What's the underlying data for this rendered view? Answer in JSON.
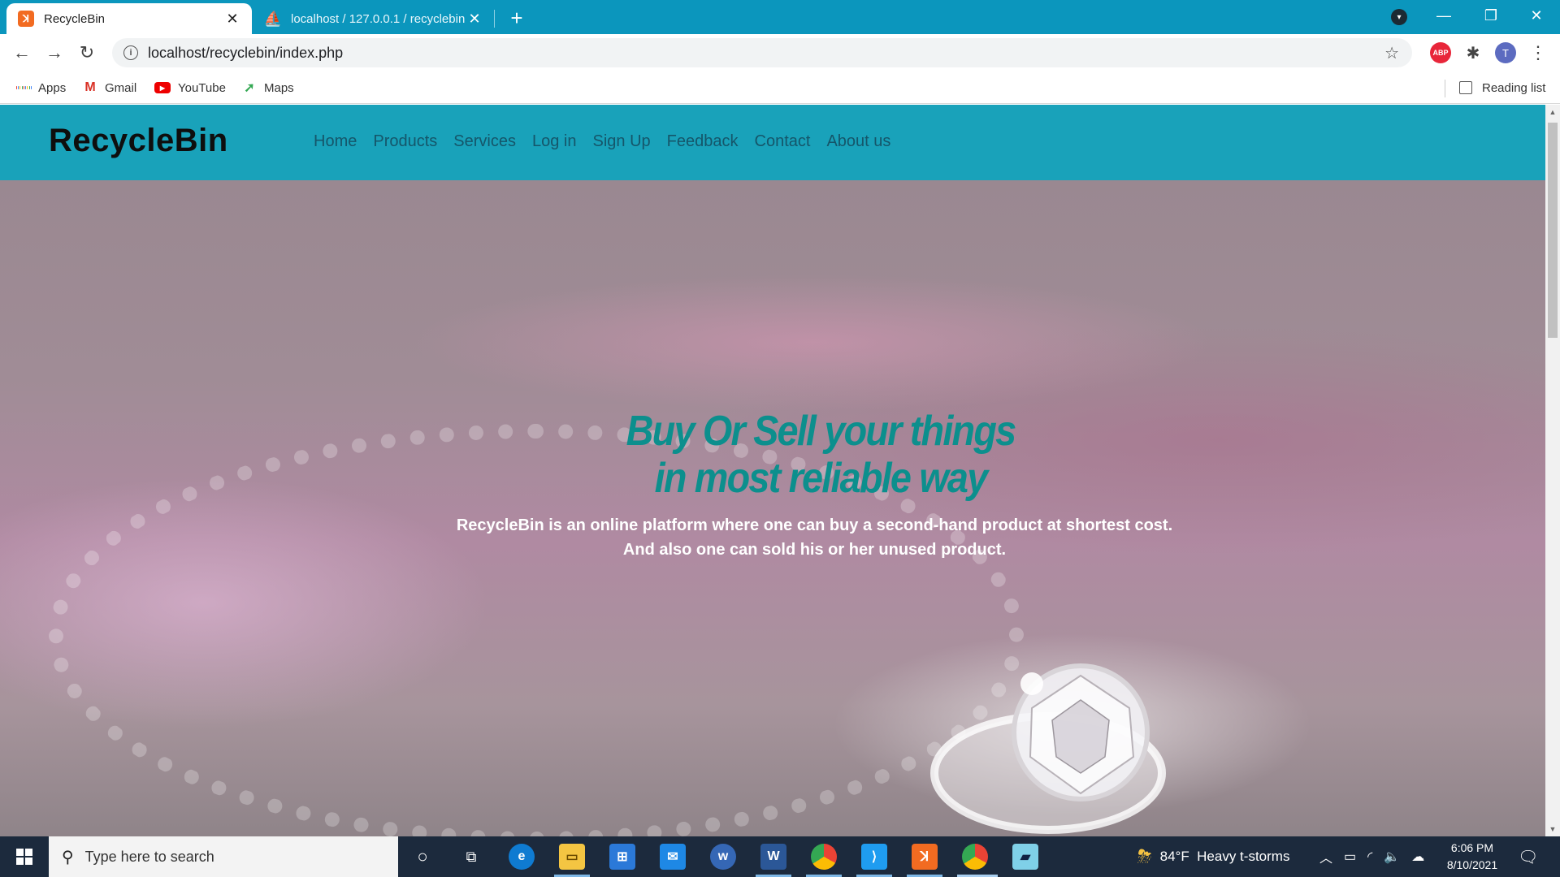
{
  "browser": {
    "tabs": [
      {
        "title": "RecycleBin",
        "favicon": "xampp-icon",
        "active": true
      },
      {
        "title": "localhost / 127.0.0.1 / recyclebin",
        "favicon": "phpmyadmin-icon",
        "active": false
      }
    ],
    "url": "localhost/recyclebin/index.php",
    "profile_initial": "T",
    "abp_label": "ABP",
    "bookmarks": [
      {
        "label": "Apps",
        "icon": "apps-grid-icon"
      },
      {
        "label": "Gmail",
        "icon": "gmail-icon"
      },
      {
        "label": "YouTube",
        "icon": "youtube-icon"
      },
      {
        "label": "Maps",
        "icon": "maps-icon"
      }
    ],
    "reading_list": "Reading list"
  },
  "site": {
    "brand": "RecycleBin",
    "nav": [
      "Home",
      "Products",
      "Services",
      "Log in",
      "Sign Up",
      "Feedback",
      "Contact",
      "About us"
    ],
    "hero": {
      "title_line1": "Buy Or Sell your things",
      "title_line2": "in most reliable way",
      "text": "RecycleBin is an online platform where one can buy a second-hand product at shortest cost. And also one can sold his or her unused product."
    },
    "colors": {
      "header_bg": "#19a2ba",
      "brand_text": "#0e0e0e",
      "nav_text": "#15566a",
      "hero_title": "#0c8f8d",
      "hero_text": "#ffffff",
      "chrome_frame": "#0b96bd"
    }
  },
  "taskbar": {
    "search_placeholder": "Type here to search",
    "apps": [
      "cortana-icon",
      "task-view-icon",
      "edge-icon",
      "file-explorer-icon",
      "store-icon",
      "mail-icon",
      "wordweb-icon",
      "word-icon",
      "chrome-icon",
      "vscode-icon",
      "xampp-icon",
      "chrome-profile-icon",
      "notepad-icon"
    ],
    "weather": "84°F  Heavy t-storms",
    "time": "6:06 PM",
    "date": "8/10/2021"
  }
}
